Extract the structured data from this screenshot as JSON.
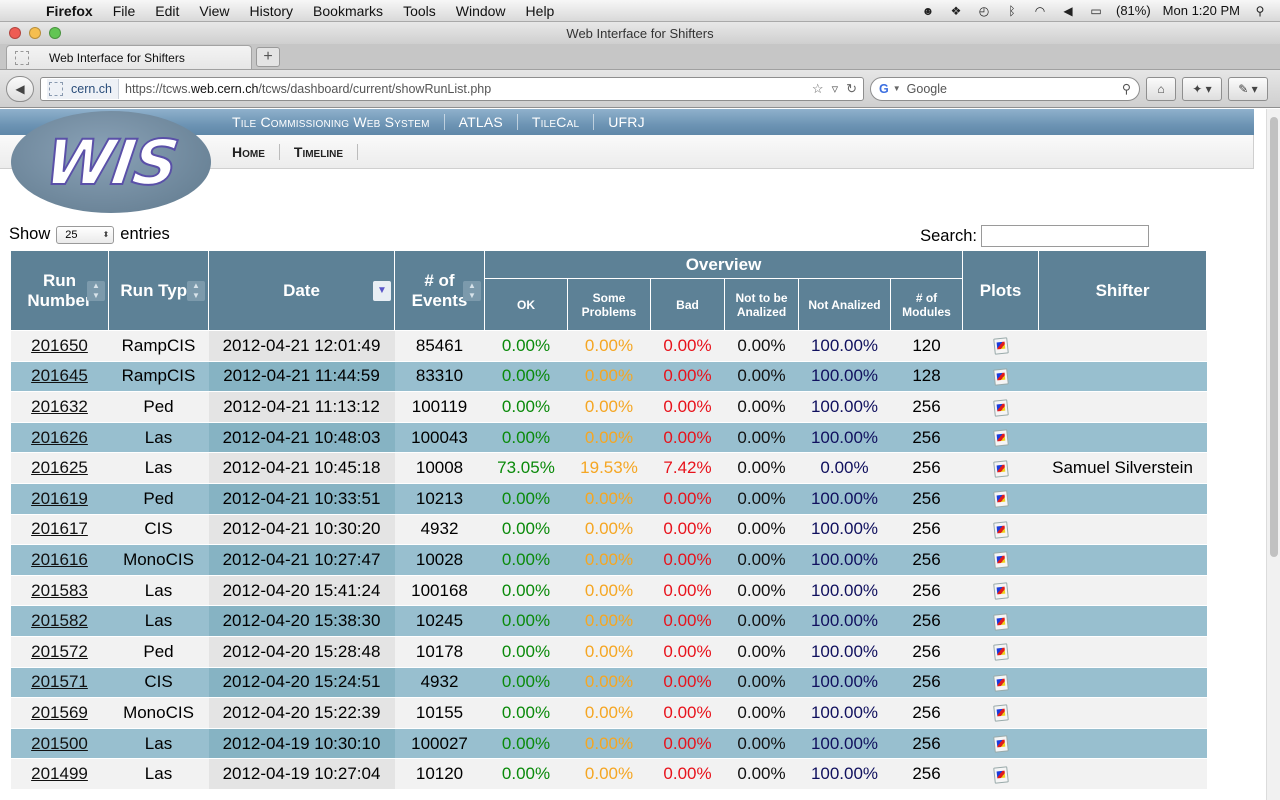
{
  "menubar": {
    "app": "Firefox",
    "items": [
      "File",
      "Edit",
      "View",
      "History",
      "Bookmarks",
      "Tools",
      "Window",
      "Help"
    ],
    "battery": "(81%)",
    "clock": "Mon 1:20 PM"
  },
  "window": {
    "title": "Web Interface for Shifters"
  },
  "tabs": [
    {
      "label": "Web Interface for Shifters"
    }
  ],
  "navbar": {
    "site": "cern.ch",
    "url_prefix": "https://tcws.",
    "url_host": "web.cern.ch",
    "url_path": "/tcws/dashboard/current/showRunList.php",
    "search_placeholder": "Google"
  },
  "site_header": {
    "logo_text": "WIS",
    "top_links": [
      "Tile Commissioning Web System",
      "ATLAS",
      "TileCal",
      "UFRJ"
    ],
    "nav_links": [
      "Home",
      "Timeline"
    ]
  },
  "controls": {
    "show_label": "Show",
    "entries_value": "25",
    "entries_label": "entries",
    "search_label": "Search:"
  },
  "table": {
    "headers": {
      "run_number": "Run Number",
      "run_type": "Run Type",
      "date": "Date",
      "events": "# of Events",
      "overview": "Overview",
      "plots": "Plots",
      "shifter": "Shifter",
      "ok": "OK",
      "some": "Some Problems",
      "bad": "Bad",
      "not_to_be": "Not to be Analized",
      "not_analized": "Not Analized",
      "modules": "# of Modules"
    },
    "rows": [
      [
        "201650",
        "RampCIS",
        "2012-04-21 12:01:49",
        "85461",
        "0.00%",
        "0.00%",
        "0.00%",
        "0.00%",
        "100.00%",
        "120",
        ""
      ],
      [
        "201645",
        "RampCIS",
        "2012-04-21 11:44:59",
        "83310",
        "0.00%",
        "0.00%",
        "0.00%",
        "0.00%",
        "100.00%",
        "128",
        ""
      ],
      [
        "201632",
        "Ped",
        "2012-04-21 11:13:12",
        "100119",
        "0.00%",
        "0.00%",
        "0.00%",
        "0.00%",
        "100.00%",
        "256",
        ""
      ],
      [
        "201626",
        "Las",
        "2012-04-21 10:48:03",
        "100043",
        "0.00%",
        "0.00%",
        "0.00%",
        "0.00%",
        "100.00%",
        "256",
        ""
      ],
      [
        "201625",
        "Las",
        "2012-04-21 10:45:18",
        "10008",
        "73.05%",
        "19.53%",
        "7.42%",
        "0.00%",
        "0.00%",
        "256",
        "Samuel Silverstein"
      ],
      [
        "201619",
        "Ped",
        "2012-04-21 10:33:51",
        "10213",
        "0.00%",
        "0.00%",
        "0.00%",
        "0.00%",
        "100.00%",
        "256",
        ""
      ],
      [
        "201617",
        "CIS",
        "2012-04-21 10:30:20",
        "4932",
        "0.00%",
        "0.00%",
        "0.00%",
        "0.00%",
        "100.00%",
        "256",
        ""
      ],
      [
        "201616",
        "MonoCIS",
        "2012-04-21 10:27:47",
        "10028",
        "0.00%",
        "0.00%",
        "0.00%",
        "0.00%",
        "100.00%",
        "256",
        ""
      ],
      [
        "201583",
        "Las",
        "2012-04-20 15:41:24",
        "100168",
        "0.00%",
        "0.00%",
        "0.00%",
        "0.00%",
        "100.00%",
        "256",
        ""
      ],
      [
        "201582",
        "Las",
        "2012-04-20 15:38:30",
        "10245",
        "0.00%",
        "0.00%",
        "0.00%",
        "0.00%",
        "100.00%",
        "256",
        ""
      ],
      [
        "201572",
        "Ped",
        "2012-04-20 15:28:48",
        "10178",
        "0.00%",
        "0.00%",
        "0.00%",
        "0.00%",
        "100.00%",
        "256",
        ""
      ],
      [
        "201571",
        "CIS",
        "2012-04-20 15:24:51",
        "4932",
        "0.00%",
        "0.00%",
        "0.00%",
        "0.00%",
        "100.00%",
        "256",
        ""
      ],
      [
        "201569",
        "MonoCIS",
        "2012-04-20 15:22:39",
        "10155",
        "0.00%",
        "0.00%",
        "0.00%",
        "0.00%",
        "100.00%",
        "256",
        ""
      ],
      [
        "201500",
        "Las",
        "2012-04-19 10:30:10",
        "100027",
        "0.00%",
        "0.00%",
        "0.00%",
        "0.00%",
        "100.00%",
        "256",
        ""
      ],
      [
        "201499",
        "Las",
        "2012-04-19 10:27:04",
        "10120",
        "0.00%",
        "0.00%",
        "0.00%",
        "0.00%",
        "100.00%",
        "256",
        ""
      ]
    ]
  },
  "colors": {
    "header_bg": "#5d8196",
    "row_alt": "#98bfcf",
    "ok": "#0a8a0a",
    "some_problems": "#f5a623",
    "bad": "#e8121b",
    "not_analized": "#10105e"
  },
  "icons": {
    "plot": "plot-thumbnail-icon",
    "sort": "sort-arrows-icon",
    "sort_active": "sort-desc-icon"
  }
}
